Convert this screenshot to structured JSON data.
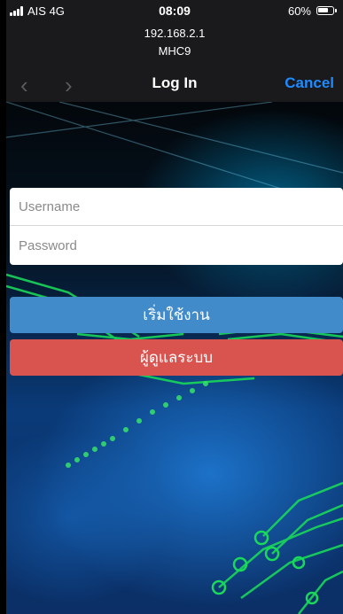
{
  "status_bar": {
    "carrier": "AIS  4G",
    "time": "08:09",
    "battery_percent": "60%",
    "battery_level": 0.6
  },
  "address": {
    "ip": "192.168.2.1",
    "ssid": "MHC9"
  },
  "nav": {
    "title": "Log In",
    "cancel_label": "Cancel"
  },
  "login": {
    "username_placeholder": "Username",
    "password_placeholder": "Password",
    "start_button": "เริ่มใช้งาน",
    "admin_button": "ผู้ดูแลระบบ"
  },
  "colors": {
    "start_button": "#428bca",
    "admin_button": "#d9534f",
    "cancel_link": "#1e8bff"
  }
}
